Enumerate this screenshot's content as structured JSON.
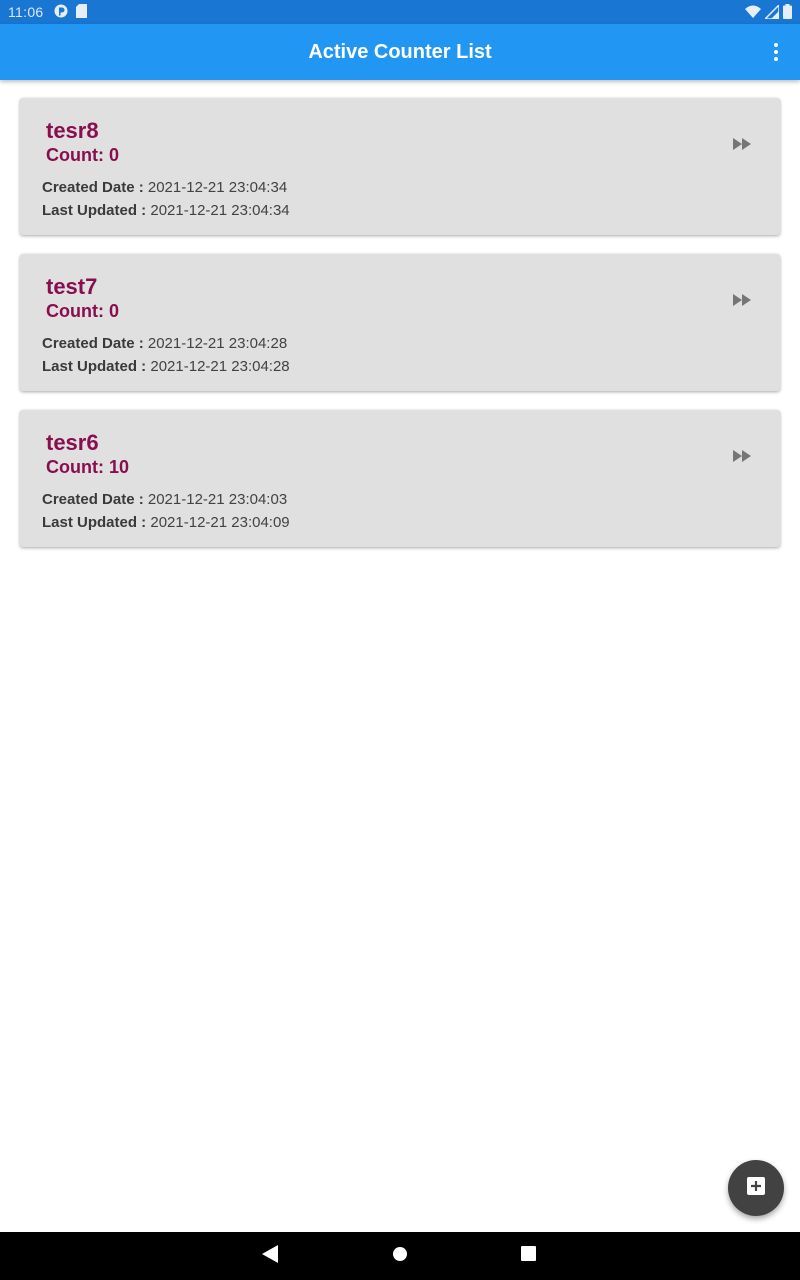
{
  "status_bar": {
    "time": "11:06",
    "icons": [
      "podcast-icon",
      "sd-card-icon",
      "wifi-icon",
      "signal-icon",
      "battery-icon"
    ]
  },
  "app_bar": {
    "title": "Active Counter List",
    "menu_icon": "more-vert-icon"
  },
  "colors": {
    "status_bar": "#1976D2",
    "app_bar": "#2196F3",
    "card_bg": "#E0E0E0",
    "accent_text": "#880E4F",
    "fab_bg": "#424242"
  },
  "counters": [
    {
      "name": "tesr8",
      "count_label": "Count: 0",
      "created_label": "Created Date :",
      "created_value": "2021-12-21 23:04:34",
      "updated_label": "Last Updated :",
      "updated_value": "2021-12-21 23:04:34",
      "action_icon": "fast-forward-icon"
    },
    {
      "name": "test7",
      "count_label": "Count: 0",
      "created_label": "Created Date :",
      "created_value": "2021-12-21 23:04:28",
      "updated_label": "Last Updated :",
      "updated_value": "2021-12-21 23:04:28",
      "action_icon": "fast-forward-icon"
    },
    {
      "name": "tesr6",
      "count_label": "Count: 10",
      "created_label": "Created Date :",
      "created_value": "2021-12-21 23:04:03",
      "updated_label": "Last Updated :",
      "updated_value": "2021-12-21 23:04:09",
      "action_icon": "fast-forward-icon"
    }
  ],
  "fab": {
    "icon": "add-box-icon"
  },
  "nav_bar": {
    "buttons": [
      "back-icon",
      "home-icon",
      "recents-icon"
    ]
  }
}
